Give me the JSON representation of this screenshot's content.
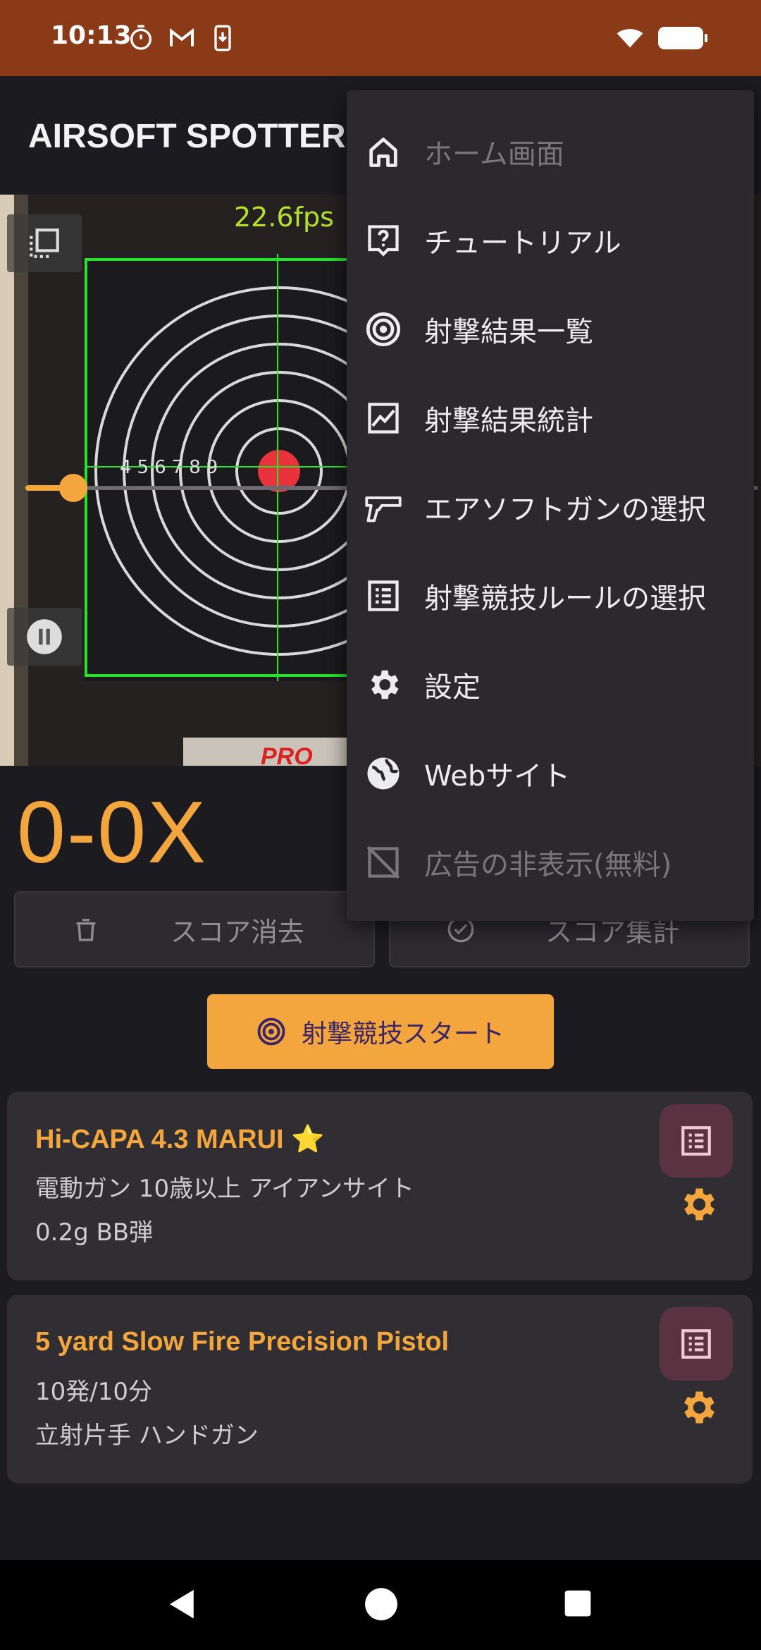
{
  "status_bar": {
    "time": "10:13",
    "icons": [
      "stopwatch-icon",
      "gmail-icon",
      "download-icon",
      "wifi-icon",
      "battery-icon"
    ]
  },
  "app_bar": {
    "title": "AIRSOFT SPOTTER"
  },
  "camera": {
    "fps": "22.6fps",
    "ring_numbers": [
      "4",
      "5",
      "6",
      "7",
      "8",
      "9"
    ]
  },
  "score": {
    "value": "0-0X",
    "clear_label": "スコア消去",
    "total_label": "スコア集計"
  },
  "start_button": {
    "label": "射撃競技スタート"
  },
  "cards": [
    {
      "title": "Hi-CAPA 4.3 MARUI ⭐",
      "line1": "電動ガン 10歳以上 アイアンサイト",
      "line2": "0.2g BB弾"
    },
    {
      "title": "5 yard Slow Fire Precision Pistol",
      "line1": "10発/10分",
      "line2": "立射片手 ハンドガン"
    }
  ],
  "menu": {
    "items": [
      {
        "label": "ホーム画面",
        "icon": "home-icon",
        "enabled": false
      },
      {
        "label": "チュートリアル",
        "icon": "help-icon",
        "enabled": true
      },
      {
        "label": "射撃結果一覧",
        "icon": "target-icon",
        "enabled": true
      },
      {
        "label": "射撃結果統計",
        "icon": "chart-icon",
        "enabled": true
      },
      {
        "label": "エアソフトガンの選択",
        "icon": "pistol-icon",
        "enabled": true
      },
      {
        "label": "射撃競技ルールの選択",
        "icon": "list-icon",
        "enabled": true
      },
      {
        "label": "設定",
        "icon": "gear-icon",
        "enabled": true
      },
      {
        "label": "Webサイト",
        "icon": "globe-icon",
        "enabled": true
      },
      {
        "label": "広告の非表示(無料)",
        "icon": "ad-off-icon",
        "enabled": false
      }
    ]
  },
  "colors": {
    "accent": "#f2a63d",
    "status_bar": "#8a3a17",
    "background": "#1c1b1f",
    "card": "#302e33",
    "menu": "#2b292e",
    "list_button": "#5b3240",
    "fps_text": "#b4e12c"
  }
}
